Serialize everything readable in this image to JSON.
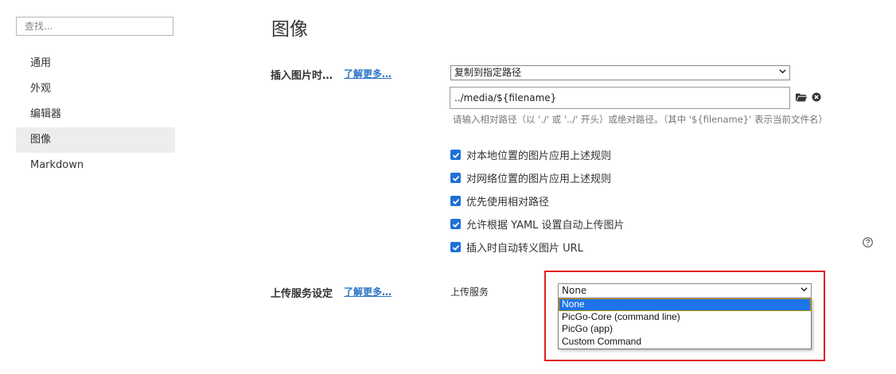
{
  "sidebar": {
    "search_placeholder": "查找...",
    "items": [
      {
        "label": "通用"
      },
      {
        "label": "外观"
      },
      {
        "label": "编辑器"
      },
      {
        "label": "图像",
        "active": true
      },
      {
        "label": "Markdown"
      }
    ]
  },
  "main": {
    "title": "图像",
    "insert": {
      "label": "插入图片时…",
      "learn_more": "了解更多…",
      "action_selected": "复制到指定路径",
      "path_value": "../media/${filename}",
      "hint": "请输入相对路径（以 './' 或 '../' 开头）或绝对路径。（其中 '${filename}' 表示当前文件名）",
      "icons": [
        "folder-icon",
        "clear-icon"
      ]
    },
    "checkboxes": [
      {
        "label": "对本地位置的图片应用上述规则",
        "checked": true
      },
      {
        "label": "对网络位置的图片应用上述规则",
        "checked": true
      },
      {
        "label": "优先使用相对路径",
        "checked": true
      },
      {
        "label": "允许根据 YAML 设置自动上传图片",
        "checked": true
      },
      {
        "label": "插入时自动转义图片 URL",
        "checked": true
      }
    ],
    "upload": {
      "label": "上传服务设定",
      "learn_more": "了解更多…",
      "service_label": "上传服务",
      "service_selected": "None",
      "options": [
        "None",
        "PicGo-Core (command line)",
        "PicGo (app)",
        "Custom Command"
      ]
    }
  },
  "colors": {
    "accent": "#1e71d8",
    "link": "#2a73c7",
    "highlight_border": "#e02020",
    "active_nav_bg": "#ededed"
  }
}
